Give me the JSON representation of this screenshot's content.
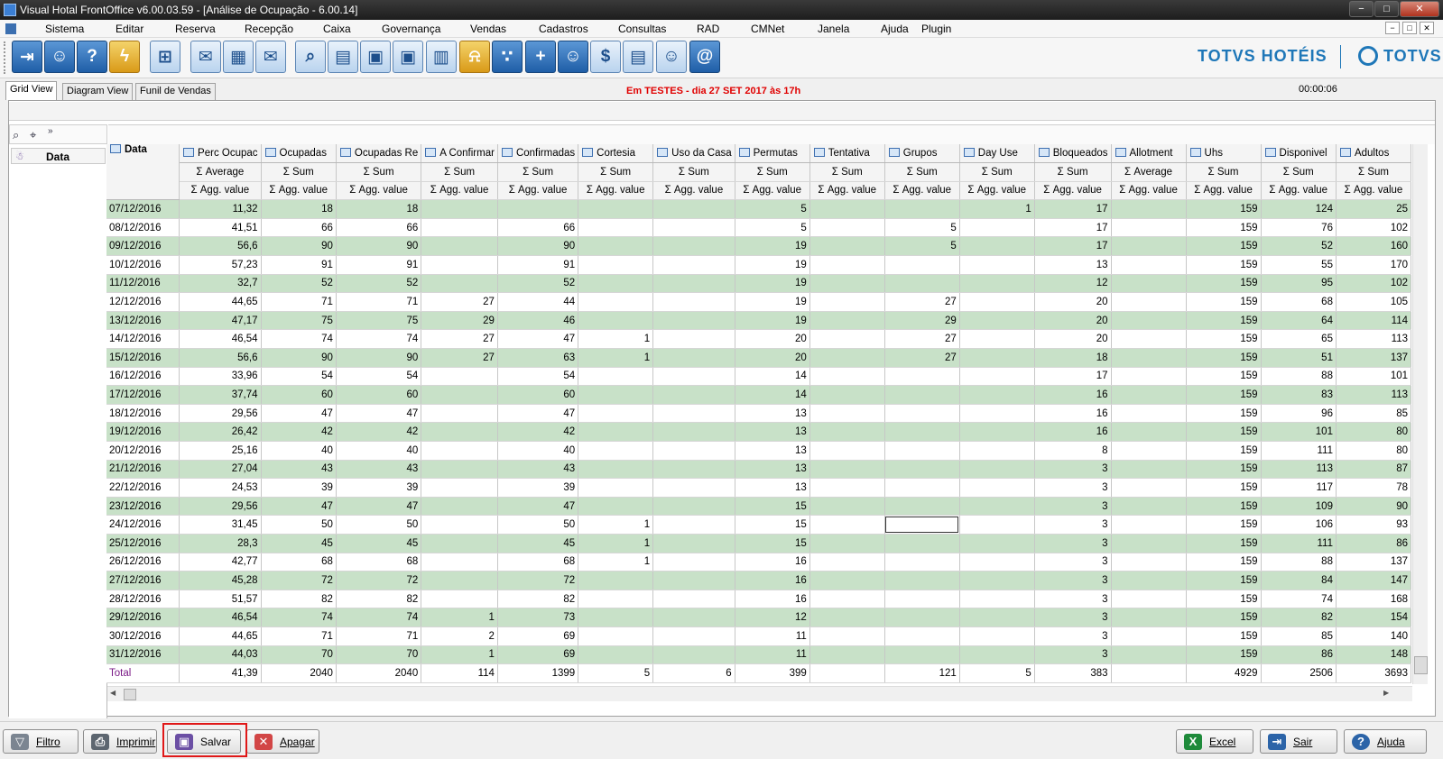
{
  "window": {
    "title": "Visual Hotal FrontOffice v6.00.03.59 - [Análise de Ocupação - 6.00.14]",
    "controls": [
      "−",
      "□",
      "✕"
    ]
  },
  "menu": {
    "items": [
      "Sistema",
      "Editar",
      "Reserva",
      "Recepção",
      "Caixa",
      "Governança",
      "Vendas",
      "Cadastros",
      "Consultas",
      "RAD",
      "CMNet",
      "Janela",
      "Ajuda",
      "Plugin"
    ],
    "mdi_controls": [
      "−",
      "□",
      "✕"
    ]
  },
  "toolbar": {
    "buttons": [
      {
        "icon": "exit-door-icon",
        "glyph": "⇥"
      },
      {
        "icon": "user-key-icon",
        "glyph": "☺"
      },
      {
        "icon": "help-icon",
        "glyph": "?"
      },
      {
        "icon": "lightning-icon",
        "glyph": "ϟ"
      },
      {
        "icon": "network-icon",
        "glyph": "⊞"
      },
      {
        "icon": "mail-icon",
        "glyph": "✉"
      },
      {
        "icon": "calculator-icon",
        "glyph": "▦"
      },
      {
        "icon": "mail-send-icon",
        "glyph": "✉"
      },
      {
        "icon": "search-icon",
        "glyph": "⌕"
      },
      {
        "icon": "calendar-icon",
        "glyph": "▤"
      },
      {
        "icon": "guest-card-icon",
        "glyph": "▣"
      },
      {
        "icon": "room-board-icon",
        "glyph": "▣"
      },
      {
        "icon": "guest-document-icon",
        "glyph": "▥"
      },
      {
        "icon": "bell-icon",
        "glyph": "⍾"
      },
      {
        "icon": "footprints-icon",
        "glyph": "∵"
      },
      {
        "icon": "add-guest-icon",
        "glyph": "+"
      },
      {
        "icon": "group-icon",
        "glyph": "☺"
      },
      {
        "icon": "invoice-icon",
        "glyph": "$"
      },
      {
        "icon": "cash-register-icon",
        "glyph": "▤"
      },
      {
        "icon": "maid-icon",
        "glyph": "☺"
      },
      {
        "icon": "email-at-icon",
        "glyph": "@"
      }
    ],
    "brand_text": "TOTVS HOTÉIS",
    "brand_logo_text": "TOTVS"
  },
  "tabs": [
    "Grid View",
    "Diagram View",
    "Funil de Vendas"
  ],
  "notice": "Em TESTES - dia 27 SET 2017 às 17h",
  "timer": "00:00:06",
  "pivot": {
    "row_field": "Data",
    "data_corner": "Data",
    "columns": [
      {
        "name": "Perc Ocupac",
        "summary": "Average"
      },
      {
        "name": "Ocupadas",
        "summary": "Sum"
      },
      {
        "name": "Ocupadas Re",
        "summary": "Sum"
      },
      {
        "name": "A Confirmar",
        "summary": "Sum"
      },
      {
        "name": "Confirmadas",
        "summary": "Sum"
      },
      {
        "name": "Cortesia",
        "summary": "Sum"
      },
      {
        "name": "Uso da Casa",
        "summary": "Sum"
      },
      {
        "name": "Permutas",
        "summary": "Sum"
      },
      {
        "name": "Tentativa",
        "summary": "Sum"
      },
      {
        "name": "Grupos",
        "summary": "Sum"
      },
      {
        "name": "Day Use",
        "summary": "Sum"
      },
      {
        "name": "Bloqueados",
        "summary": "Sum"
      },
      {
        "name": "Allotment",
        "summary": "Average"
      },
      {
        "name": "Uhs",
        "summary": "Sum"
      },
      {
        "name": "Disponivel",
        "summary": "Sum"
      },
      {
        "name": "Adultos",
        "summary": "Sum"
      }
    ],
    "agg_label": "Agg. value",
    "rows": [
      {
        "date": "07/12/2016",
        "values": [
          "11,32",
          "18",
          "18",
          "",
          "",
          "",
          "",
          "5",
          "",
          "",
          "1",
          "17",
          "",
          "159",
          "124",
          "25"
        ]
      },
      {
        "date": "08/12/2016",
        "values": [
          "41,51",
          "66",
          "66",
          "",
          "66",
          "",
          "",
          "5",
          "",
          "5",
          "",
          "17",
          "",
          "159",
          "76",
          "102"
        ]
      },
      {
        "date": "09/12/2016",
        "values": [
          "56,6",
          "90",
          "90",
          "",
          "90",
          "",
          "",
          "19",
          "",
          "5",
          "",
          "17",
          "",
          "159",
          "52",
          "160"
        ]
      },
      {
        "date": "10/12/2016",
        "values": [
          "57,23",
          "91",
          "91",
          "",
          "91",
          "",
          "",
          "19",
          "",
          "",
          "",
          "13",
          "",
          "159",
          "55",
          "170"
        ]
      },
      {
        "date": "11/12/2016",
        "values": [
          "32,7",
          "52",
          "52",
          "",
          "52",
          "",
          "",
          "19",
          "",
          "",
          "",
          "12",
          "",
          "159",
          "95",
          "102"
        ]
      },
      {
        "date": "12/12/2016",
        "values": [
          "44,65",
          "71",
          "71",
          "27",
          "44",
          "",
          "",
          "19",
          "",
          "27",
          "",
          "20",
          "",
          "159",
          "68",
          "105"
        ]
      },
      {
        "date": "13/12/2016",
        "values": [
          "47,17",
          "75",
          "75",
          "29",
          "46",
          "",
          "",
          "19",
          "",
          "29",
          "",
          "20",
          "",
          "159",
          "64",
          "114"
        ]
      },
      {
        "date": "14/12/2016",
        "values": [
          "46,54",
          "74",
          "74",
          "27",
          "47",
          "1",
          "",
          "20",
          "",
          "27",
          "",
          "20",
          "",
          "159",
          "65",
          "113"
        ]
      },
      {
        "date": "15/12/2016",
        "values": [
          "56,6",
          "90",
          "90",
          "27",
          "63",
          "1",
          "",
          "20",
          "",
          "27",
          "",
          "18",
          "",
          "159",
          "51",
          "137"
        ]
      },
      {
        "date": "16/12/2016",
        "values": [
          "33,96",
          "54",
          "54",
          "",
          "54",
          "",
          "",
          "14",
          "",
          "",
          "",
          "17",
          "",
          "159",
          "88",
          "101"
        ]
      },
      {
        "date": "17/12/2016",
        "values": [
          "37,74",
          "60",
          "60",
          "",
          "60",
          "",
          "",
          "14",
          "",
          "",
          "",
          "16",
          "",
          "159",
          "83",
          "113"
        ]
      },
      {
        "date": "18/12/2016",
        "values": [
          "29,56",
          "47",
          "47",
          "",
          "47",
          "",
          "",
          "13",
          "",
          "",
          "",
          "16",
          "",
          "159",
          "96",
          "85"
        ]
      },
      {
        "date": "19/12/2016",
        "values": [
          "26,42",
          "42",
          "42",
          "",
          "42",
          "",
          "",
          "13",
          "",
          "",
          "",
          "16",
          "",
          "159",
          "101",
          "80"
        ]
      },
      {
        "date": "20/12/2016",
        "values": [
          "25,16",
          "40",
          "40",
          "",
          "40",
          "",
          "",
          "13",
          "",
          "",
          "",
          "8",
          "",
          "159",
          "111",
          "80"
        ]
      },
      {
        "date": "21/12/2016",
        "values": [
          "27,04",
          "43",
          "43",
          "",
          "43",
          "",
          "",
          "13",
          "",
          "",
          "",
          "3",
          "",
          "159",
          "113",
          "87"
        ]
      },
      {
        "date": "22/12/2016",
        "values": [
          "24,53",
          "39",
          "39",
          "",
          "39",
          "",
          "",
          "13",
          "",
          "",
          "",
          "3",
          "",
          "159",
          "117",
          "78"
        ]
      },
      {
        "date": "23/12/2016",
        "values": [
          "29,56",
          "47",
          "47",
          "",
          "47",
          "",
          "",
          "15",
          "",
          "",
          "",
          "3",
          "",
          "159",
          "109",
          "90"
        ]
      },
      {
        "date": "24/12/2016",
        "values": [
          "31,45",
          "50",
          "50",
          "",
          "50",
          "1",
          "",
          "15",
          "",
          "",
          "",
          "3",
          "",
          "159",
          "106",
          "93"
        ]
      },
      {
        "date": "25/12/2016",
        "values": [
          "28,3",
          "45",
          "45",
          "",
          "45",
          "1",
          "",
          "15",
          "",
          "",
          "",
          "3",
          "",
          "159",
          "111",
          "86"
        ]
      },
      {
        "date": "26/12/2016",
        "values": [
          "42,77",
          "68",
          "68",
          "",
          "68",
          "1",
          "",
          "16",
          "",
          "",
          "",
          "3",
          "",
          "159",
          "88",
          "137"
        ]
      },
      {
        "date": "27/12/2016",
        "values": [
          "45,28",
          "72",
          "72",
          "",
          "72",
          "",
          "",
          "16",
          "",
          "",
          "",
          "3",
          "",
          "159",
          "84",
          "147"
        ]
      },
      {
        "date": "28/12/2016",
        "values": [
          "51,57",
          "82",
          "82",
          "",
          "82",
          "",
          "",
          "16",
          "",
          "",
          "",
          "3",
          "",
          "159",
          "74",
          "168"
        ]
      },
      {
        "date": "29/12/2016",
        "values": [
          "46,54",
          "74",
          "74",
          "1",
          "73",
          "",
          "",
          "12",
          "",
          "",
          "",
          "3",
          "",
          "159",
          "82",
          "154"
        ]
      },
      {
        "date": "30/12/2016",
        "values": [
          "44,65",
          "71",
          "71",
          "2",
          "69",
          "",
          "",
          "11",
          "",
          "",
          "",
          "3",
          "",
          "159",
          "85",
          "140"
        ]
      },
      {
        "date": "31/12/2016",
        "values": [
          "44,03",
          "70",
          "70",
          "1",
          "69",
          "",
          "",
          "11",
          "",
          "",
          "",
          "3",
          "",
          "159",
          "86",
          "148"
        ]
      }
    ],
    "total": {
      "label": "Total",
      "values": [
        "41,39",
        "2040",
        "2040",
        "114",
        "1399",
        "5",
        "6",
        "399",
        "",
        "121",
        "5",
        "383",
        "",
        "4929",
        "2506",
        "3693"
      ]
    }
  },
  "bottom_buttons": {
    "filtro": "Filtro",
    "imprimir": "Imprimir",
    "salvar": "Salvar",
    "apagar": "Apagar",
    "excel": "Excel",
    "sair": "Sair",
    "ajuda": "Ajuda"
  },
  "colors": {
    "row_alt": "#c8e1c8",
    "notice": "#e00000",
    "brand": "#1e77b8",
    "highlight": "#e01818"
  }
}
